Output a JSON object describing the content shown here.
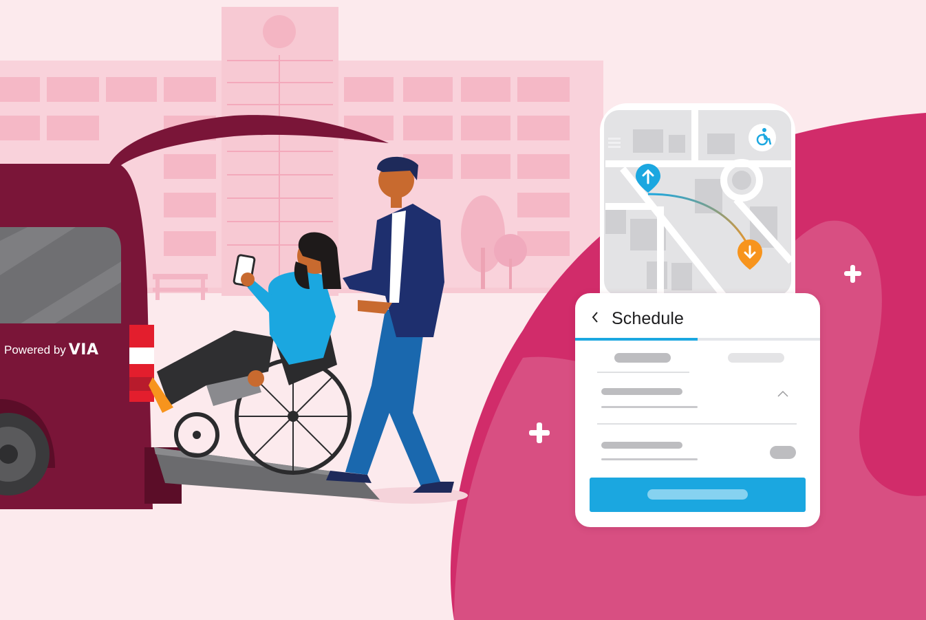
{
  "branding": {
    "powered_by": "Powered by",
    "brand": "VIA"
  },
  "schedule_card": {
    "title": "Schedule",
    "back_icon": "chevron-left-icon",
    "expand_icon": "chevron-up-icon"
  },
  "map_card": {
    "accessibility_icon": "wheelchair-icon",
    "menu_icon": "menu-icon",
    "pickup_icon": "arrow-up-pin-icon",
    "dropoff_icon": "arrow-down-pin-icon"
  },
  "colors": {
    "background": "#fceaed",
    "accent_blue": "#1ba7e0",
    "accent_orange": "#f7941d",
    "van_maroon": "#7a1538",
    "magenta": "#d12c6a"
  }
}
